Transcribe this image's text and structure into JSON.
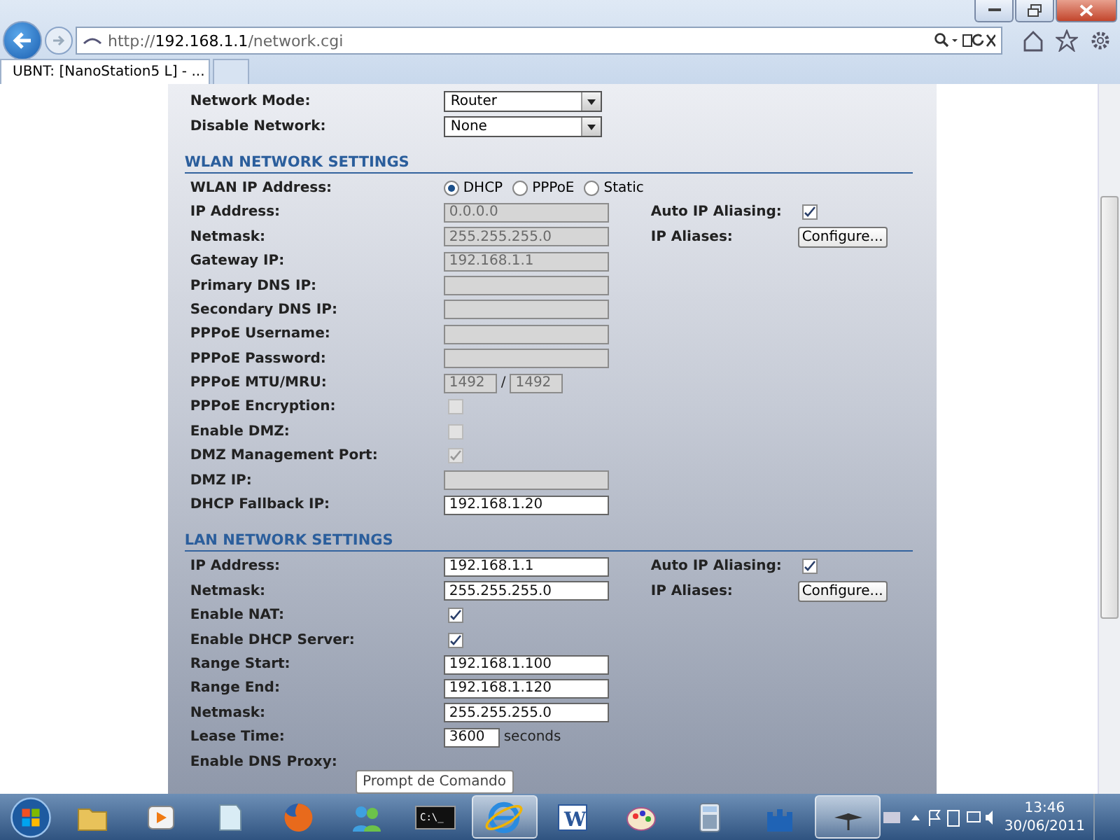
{
  "browser": {
    "address": {
      "prefix": "http://",
      "host": "192.168.1.1",
      "path": "/network.cgi"
    },
    "tabs": [
      {
        "title": "UBNT: [NanoStation5 L] - ...",
        "selected": true
      }
    ]
  },
  "top_rows": [
    {
      "label": "Network Mode:",
      "kind": "select",
      "value": "Router"
    },
    {
      "label": "Disable Network:",
      "kind": "select",
      "value": "None"
    }
  ],
  "sections": [
    {
      "title": "WLAN NETWORK SETTINGS",
      "rows": [
        {
          "label": "WLAN IP Address:",
          "kind": "radio",
          "options": [
            {
              "label": "DHCP",
              "selected": true
            },
            {
              "label": "PPPoE",
              "selected": false
            },
            {
              "label": "Static",
              "selected": false
            }
          ]
        },
        {
          "label": "IP Address:",
          "kind": "text",
          "value": "0.0.0.0",
          "disabled": true,
          "side": {
            "label": "Auto IP Aliasing:",
            "kind": "checkbox",
            "checked": true
          }
        },
        {
          "label": "Netmask:",
          "kind": "text",
          "value": "255.255.255.0",
          "disabled": true,
          "side": {
            "label": "IP Aliases:",
            "kind": "button",
            "text": "Configure..."
          }
        },
        {
          "label": "Gateway IP:",
          "kind": "text",
          "value": "192.168.1.1",
          "disabled": true
        },
        {
          "label": "Primary DNS IP:",
          "kind": "text",
          "disabled": true
        },
        {
          "label": "Secondary DNS IP:",
          "kind": "text",
          "disabled": true
        },
        {
          "label": "PPPoE Username:",
          "kind": "text",
          "disabled": true
        },
        {
          "label": "PPPoE Password:",
          "kind": "text",
          "disabled": true
        },
        {
          "label": "PPPoE MTU/MRU:",
          "kind": "pair",
          "values": [
            "1492",
            "1492"
          ],
          "separator": "/",
          "disabled": true
        },
        {
          "label": "PPPoE Encryption:",
          "kind": "checkbox",
          "checked": false,
          "disabled": true
        },
        {
          "label": "Enable DMZ:",
          "kind": "checkbox",
          "checked": false,
          "disabled": true
        },
        {
          "label": "DMZ Management Port:",
          "kind": "checkbox",
          "checked": true,
          "disabled": true
        },
        {
          "label": "DMZ IP:",
          "kind": "text",
          "disabled": true
        },
        {
          "label": "DHCP Fallback IP:",
          "kind": "text",
          "value": "192.168.1.20",
          "disabled": false
        }
      ]
    },
    {
      "title": "LAN NETWORK SETTINGS",
      "rows": [
        {
          "label": "IP Address:",
          "kind": "text",
          "value": "192.168.1.1",
          "disabled": false,
          "side": {
            "label": "Auto IP Aliasing:",
            "kind": "checkbox",
            "checked": true
          }
        },
        {
          "label": "Netmask:",
          "kind": "text",
          "value": "255.255.255.0",
          "disabled": false,
          "side": {
            "label": "IP Aliases:",
            "kind": "button",
            "text": "Configure..."
          }
        },
        {
          "label": "Enable NAT:",
          "kind": "checkbox",
          "checked": true,
          "disabled": false
        },
        {
          "label": "Enable DHCP Server:",
          "kind": "checkbox",
          "checked": true,
          "disabled": false
        },
        {
          "label": "Range Start:",
          "kind": "text",
          "value": "192.168.1.100",
          "disabled": false
        },
        {
          "label": "Range End:",
          "kind": "text",
          "value": "192.168.1.120",
          "disabled": false
        },
        {
          "label": "Netmask:",
          "kind": "text",
          "value": "255.255.255.0",
          "disabled": false
        },
        {
          "label": "Lease Time:",
          "kind": "short",
          "value": "3600",
          "suffix": "seconds",
          "disabled": false
        },
        {
          "label": "Enable DNS Proxy:",
          "kind": "label"
        }
      ]
    }
  ],
  "tooltip": "Prompt de Comando",
  "taskbar": {
    "items": [
      {
        "kind": "start",
        "active": false
      },
      {
        "kind": "folder",
        "active": false
      },
      {
        "kind": "media",
        "active": false
      },
      {
        "kind": "notepad",
        "active": false
      },
      {
        "kind": "firefox",
        "active": false
      },
      {
        "kind": "people",
        "active": false
      },
      {
        "kind": "console",
        "active": false,
        "text": "C:\\_"
      },
      {
        "kind": "browser",
        "active": true
      },
      {
        "kind": "word",
        "active": false,
        "text": "W"
      },
      {
        "kind": "paint",
        "active": false
      },
      {
        "kind": "calculator",
        "active": false
      },
      {
        "kind": "castle",
        "active": false
      },
      {
        "kind": "ubnt",
        "active": true
      }
    ],
    "time": "13:46",
    "date": "30/06/2011"
  }
}
